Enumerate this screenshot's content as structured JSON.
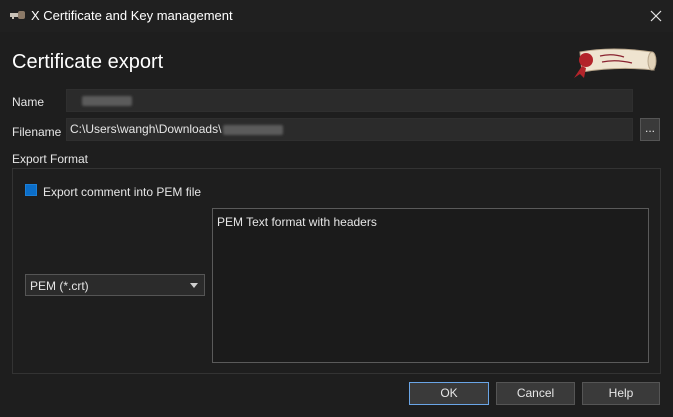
{
  "window": {
    "title": "X Certificate and Key management",
    "icon": "key-icon",
    "close_icon": "close-icon"
  },
  "header": {
    "title": "Certificate export",
    "logo_icon": "scroll-logo-icon"
  },
  "form": {
    "name_label": "Name",
    "name_value": "",
    "filename_label": "Filename",
    "filename_value": "C:\\Users\\wangh\\Downloads\\",
    "browse_label": "...",
    "export_format_label": "Export Format",
    "export_comment_label": "Export comment into PEM file",
    "export_comment_checked": true,
    "format_selected": "PEM (*.crt)",
    "format_description": "PEM Text format with headers"
  },
  "buttons": {
    "ok": "OK",
    "cancel": "Cancel",
    "help": "Help"
  },
  "colors": {
    "background": "#1e1e1e",
    "accent": "#0b6ec9",
    "ok_border": "#6aa5e6"
  }
}
